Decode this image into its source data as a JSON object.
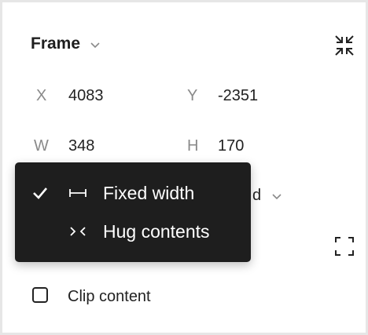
{
  "frame": {
    "title": "Frame",
    "x_label": "X",
    "x_value": "4083",
    "y_label": "Y",
    "y_value": "-2351",
    "w_label": "W",
    "w_value": "348",
    "h_label": "H",
    "h_value": "170",
    "height_mode_suffix": "d"
  },
  "menu": {
    "items": [
      {
        "label": "Fixed width",
        "checked": true,
        "icon": "fixed-width-icon"
      },
      {
        "label": "Hug contents",
        "checked": false,
        "icon": "hug-contents-icon"
      }
    ]
  },
  "clip": {
    "label": "Clip content",
    "checked": false
  },
  "colors": {
    "menu_bg": "#1e1e1e",
    "menu_text": "#ffffff",
    "label_gray": "#8a8a8a"
  }
}
